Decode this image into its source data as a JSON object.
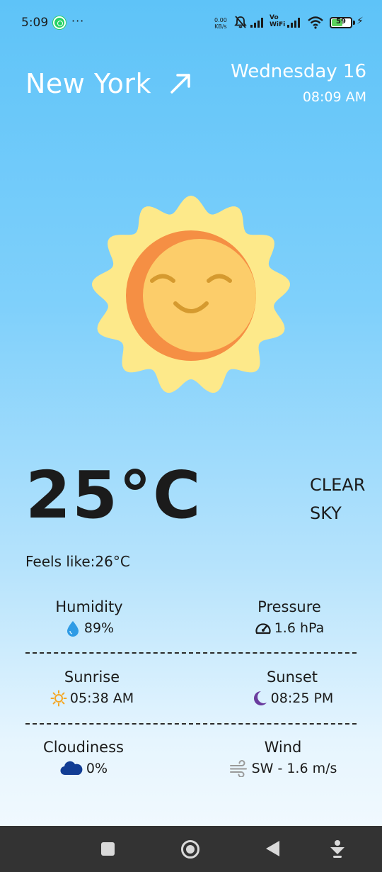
{
  "status_bar": {
    "time": "5:09",
    "more": "···",
    "network_speed_value": "0.00",
    "network_speed_unit": "KB/s",
    "vowifi_top": "Vo",
    "vowifi_bottom": "WiFi",
    "battery_level": "59",
    "battery_fraction": 0.59,
    "icons": [
      "whatsapp-icon",
      "mute-icon",
      "signal-icon",
      "wifi-icon",
      "battery-icon",
      "charging-bolt-icon"
    ]
  },
  "header": {
    "city": "New York",
    "city_icon": "arrow-up-right-icon",
    "date": "Wednesday 16",
    "time": "08:09 AM"
  },
  "weather": {
    "illustration": "smiling-sun",
    "temperature": "25°C",
    "condition_line1": "CLEAR",
    "condition_line2": "SKY",
    "feels_like": "Feels like:26°C"
  },
  "details": {
    "humidity": {
      "label": "Humidity",
      "value": "89%",
      "icon": "water-drop-icon"
    },
    "pressure": {
      "label": "Pressure",
      "value": "1.6 hPa",
      "icon": "gauge-icon"
    },
    "sunrise": {
      "label": "Sunrise",
      "value": "05:38 AM",
      "icon": "sun-icon"
    },
    "sunset": {
      "label": "Sunset",
      "value": "08:25 PM",
      "icon": "moon-icon"
    },
    "cloudiness": {
      "label": "Cloudiness",
      "value": "0%",
      "icon": "cloud-icon"
    },
    "wind": {
      "label": "Wind",
      "value": "SW - 1.6 m/s",
      "icon": "wind-icon"
    }
  },
  "colors": {
    "sky_top": "#5ec3f8",
    "sky_bottom": "#f6fbff",
    "text": "#1b1b1b",
    "header_text": "#ffffff",
    "sun_rays": "#fde98a",
    "sun_face": "#fccd6a",
    "sun_shadow": "#f58f44",
    "drop": "#2f9be5",
    "moon": "#6a3c9e",
    "cloud": "#123d94",
    "nav_bar": "#333333"
  },
  "nav_bar": {
    "icons": [
      "recents-square-icon",
      "home-circle-icon",
      "back-triangle-icon",
      "download-arrow-icon"
    ]
  }
}
